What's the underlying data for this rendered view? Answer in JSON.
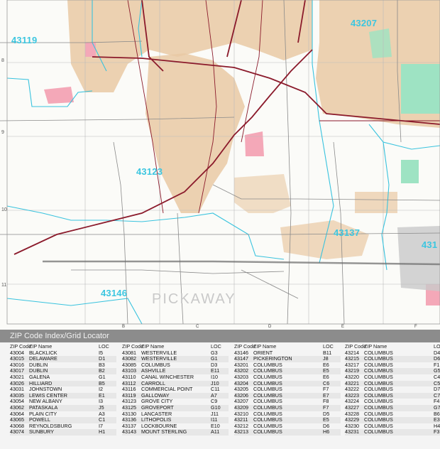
{
  "map": {
    "zip_labels": [
      "43119",
      "43207",
      "43123",
      "43137",
      "43146",
      "431"
    ],
    "county_label": "PICKAWAY",
    "row_ticks": [
      "8",
      "9",
      "10",
      "11"
    ],
    "col_ticks": [
      "B",
      "C",
      "D",
      "E",
      "F"
    ],
    "colors": {
      "urban_tan": "#e9c9a4",
      "green_area": "#9ee3c3",
      "pink_area": "#f4a8b8",
      "water_cyan": "#39c3de",
      "highway_maroon": "#8b1a2b",
      "road_grey": "#7a7a7a"
    }
  },
  "index": {
    "title": "ZIP Code Index/Grid Locator",
    "headers": {
      "zip": "ZIP Code",
      "name": "ZIP Name",
      "loc": "LOC"
    },
    "columns": [
      [
        [
          "43004",
          "BLACKLICK",
          "I5"
        ],
        [
          "43015",
          "DELAWARE",
          "D1"
        ],
        [
          "43016",
          "DUBLIN",
          "B3"
        ],
        [
          "43017",
          "DUBLIN",
          "B2"
        ],
        [
          "43021",
          "GALENA",
          "G1"
        ],
        [
          "43026",
          "HILLIARD",
          "B5"
        ],
        [
          "43031",
          "JOHNSTOWN",
          "I2"
        ],
        [
          "43035",
          "LEWIS CENTER",
          "E1"
        ],
        [
          "43054",
          "NEW ALBANY",
          "I3"
        ],
        [
          "43062",
          "PATASKALA",
          "J5"
        ],
        [
          "43064",
          "PLAIN CITY",
          "A3"
        ],
        [
          "43065",
          "POWELL",
          "C1"
        ],
        [
          "43068",
          "REYNOLDSBURG",
          "I7"
        ],
        [
          "43074",
          "SUNBURY",
          "H1"
        ]
      ],
      [
        [
          "43081",
          "WESTERVILLE",
          "G3"
        ],
        [
          "43082",
          "WESTERVILLE",
          "G1"
        ],
        [
          "43085",
          "COLUMBUS",
          "D3"
        ],
        [
          "43103",
          "ASHVILLE",
          "E11"
        ],
        [
          "43110",
          "CANAL WINCHESTER",
          "I10"
        ],
        [
          "43112",
          "CARROLL",
          "J10"
        ],
        [
          "43116",
          "COMMERCIAL POINT",
          "C11"
        ],
        [
          "43119",
          "GALLOWAY",
          "A7"
        ],
        [
          "43123",
          "GROVE CITY",
          "C9"
        ],
        [
          "43125",
          "GROVEPORT",
          "G10"
        ],
        [
          "43130",
          "LANCASTER",
          "J11"
        ],
        [
          "43136",
          "LITHOPOLIS",
          "I11"
        ],
        [
          "43137",
          "LOCKBOURNE",
          "E10"
        ],
        [
          "43143",
          "MOUNT STERLING",
          "A11"
        ]
      ],
      [
        [
          "43146",
          "ORIENT",
          "B11"
        ],
        [
          "43147",
          "PICKERINGTON",
          "J8"
        ],
        [
          "43201",
          "COLUMBUS",
          "E6"
        ],
        [
          "43202",
          "COLUMBUS",
          "E5"
        ],
        [
          "43203",
          "COLUMBUS",
          "E6"
        ],
        [
          "43204",
          "COLUMBUS",
          "C6"
        ],
        [
          "43205",
          "COLUMBUS",
          "F7"
        ],
        [
          "43206",
          "COLUMBUS",
          "E7"
        ],
        [
          "43207",
          "COLUMBUS",
          "F8"
        ],
        [
          "43209",
          "COLUMBUS",
          "F7"
        ],
        [
          "43210",
          "COLUMBUS",
          "D5"
        ],
        [
          "43211",
          "COLUMBUS",
          "E5"
        ],
        [
          "43212",
          "COLUMBUS",
          "D6"
        ],
        [
          "43213",
          "COLUMBUS",
          "H6"
        ]
      ],
      [
        [
          "43214",
          "COLUMBUS",
          "D4"
        ],
        [
          "43215",
          "COLUMBUS",
          "D6"
        ],
        [
          "43217",
          "COLUMBUS",
          "F1"
        ],
        [
          "43219",
          "COLUMBUS",
          "G5"
        ],
        [
          "43220",
          "COLUMBUS",
          "C4"
        ],
        [
          "43221",
          "COLUMBUS",
          "C5"
        ],
        [
          "43222",
          "COLUMBUS",
          "D7"
        ],
        [
          "43223",
          "COLUMBUS",
          "C7"
        ],
        [
          "43224",
          "COLUMBUS",
          "F4"
        ],
        [
          "43227",
          "COLUMBUS",
          "G7"
        ],
        [
          "43228",
          "COLUMBUS",
          "B6"
        ],
        [
          "43229",
          "COLUMBUS",
          "E3"
        ],
        [
          "43230",
          "COLUMBUS",
          "H4"
        ],
        [
          "43231",
          "COLUMBUS",
          "F3"
        ]
      ]
    ]
  }
}
